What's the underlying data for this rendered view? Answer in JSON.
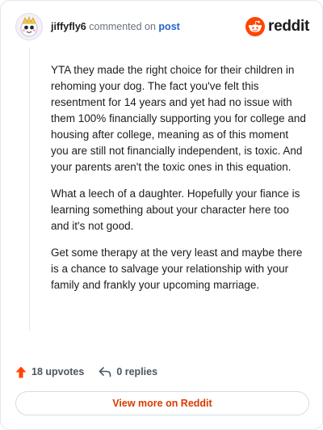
{
  "comment": {
    "username": "jiffyfly6",
    "verb": "commented on",
    "link_label": "post",
    "paragraphs": [
      "YTA they made the right choice for their children in rehoming your dog. The fact you've felt this resentment for 14 years and yet had no issue with them 100% financially supporting you for college and housing after college, meaning as of this moment you are still not financially independent, is toxic. And your parents aren't the toxic ones in this equation.",
      "What a leech of a daughter. Hopefully your fiance is learning something about your character here too and it's not good.",
      "Get some therapy at the very least and maybe there is a chance to salvage your relationship with your family and frankly your upcoming marriage."
    ]
  },
  "brand": {
    "name": "reddit",
    "icon": "reddit-snoo-icon",
    "color": "#ff4500"
  },
  "actions": {
    "upvotes": "18 upvotes",
    "upvote_icon": "upvote-arrow-icon",
    "replies": "0 replies",
    "reply_icon": "reply-arrow-icon"
  },
  "footer": {
    "view_more": "View more on Reddit"
  },
  "colors": {
    "accent": "#ff4500",
    "link": "#2563c9",
    "view_more_text": "#d93a00",
    "muted": "#6b7280"
  }
}
